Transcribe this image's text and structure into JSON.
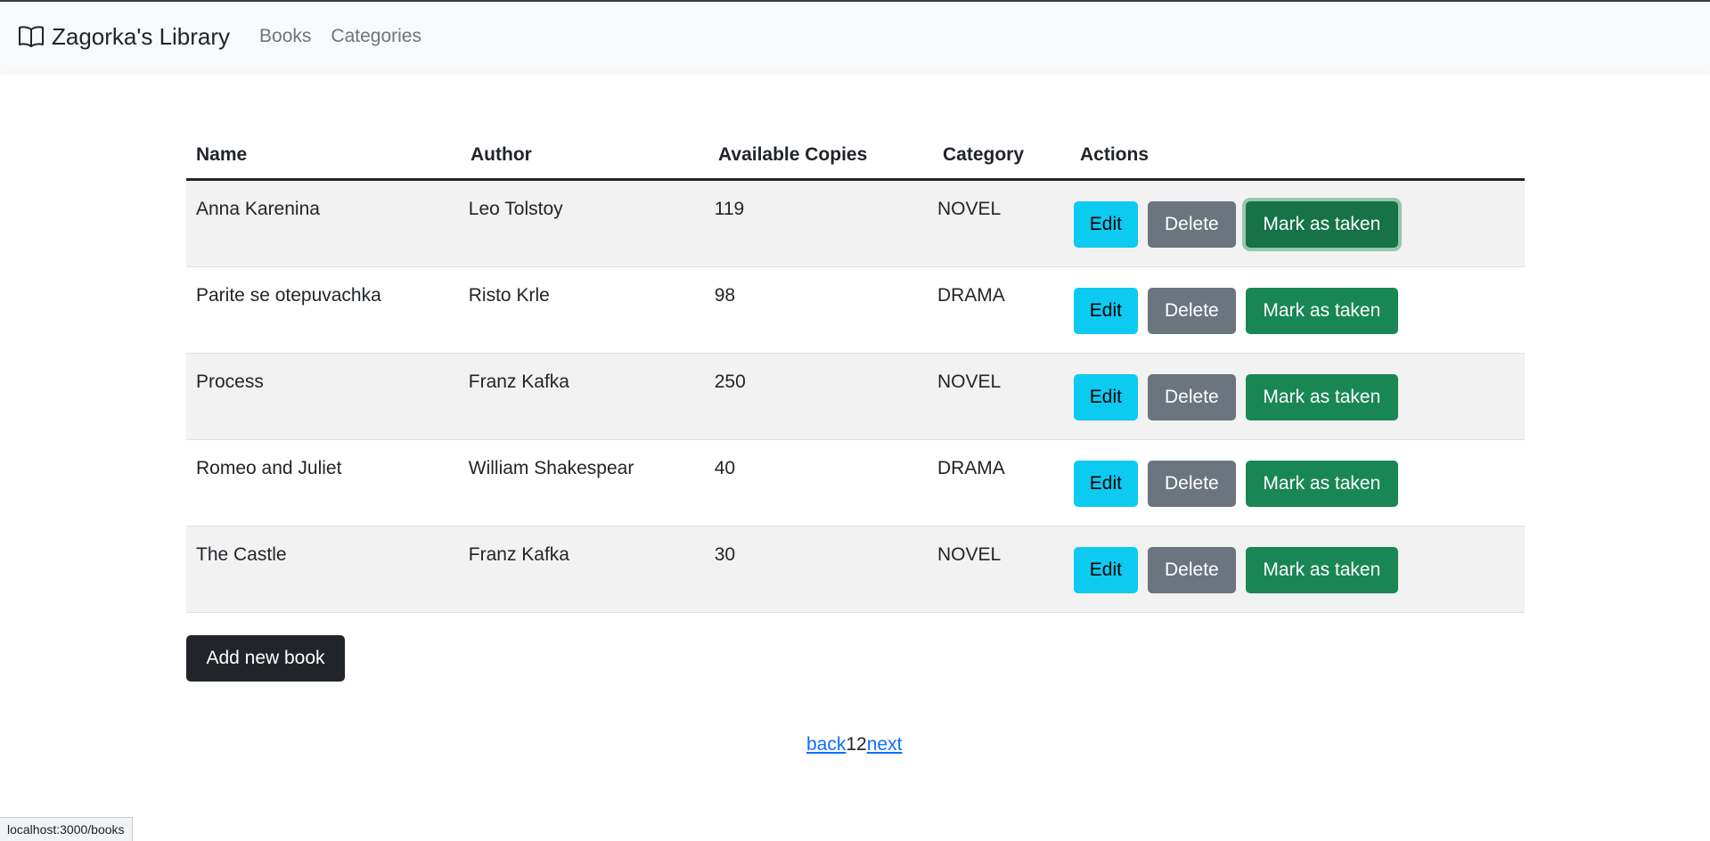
{
  "navbar": {
    "brand": "Zagorka's Library",
    "links": [
      "Books",
      "Categories"
    ]
  },
  "table": {
    "headers": [
      "Name",
      "Author",
      "Available Copies",
      "Category",
      "Actions"
    ],
    "rows": [
      {
        "name": "Anna Karenina",
        "author": "Leo Tolstoy",
        "copies": "119",
        "category": "NOVEL"
      },
      {
        "name": "Parite se otepuvachka",
        "author": "Risto Krle",
        "copies": "98",
        "category": "DRAMA"
      },
      {
        "name": "Process",
        "author": "Franz Kafka",
        "copies": "250",
        "category": "NOVEL"
      },
      {
        "name": "Romeo and Juliet",
        "author": "William Shakespear",
        "copies": "40",
        "category": "DRAMA"
      },
      {
        "name": "The Castle",
        "author": "Franz Kafka",
        "copies": "30",
        "category": "NOVEL"
      }
    ],
    "actions": {
      "edit": "Edit",
      "delete": "Delete",
      "take": "Mark as taken"
    }
  },
  "add_button": "Add new book",
  "pagination": {
    "back": "back",
    "page1": "1",
    "page2": "2",
    "next": "next"
  },
  "status_url": "localhost:3000/books",
  "colors": {
    "info": "#0dcaf0",
    "secondary": "#6c757d",
    "success": "#198754",
    "dark": "#212529",
    "link": "#0d6efd"
  },
  "icons": {
    "brand": "book-icon"
  }
}
